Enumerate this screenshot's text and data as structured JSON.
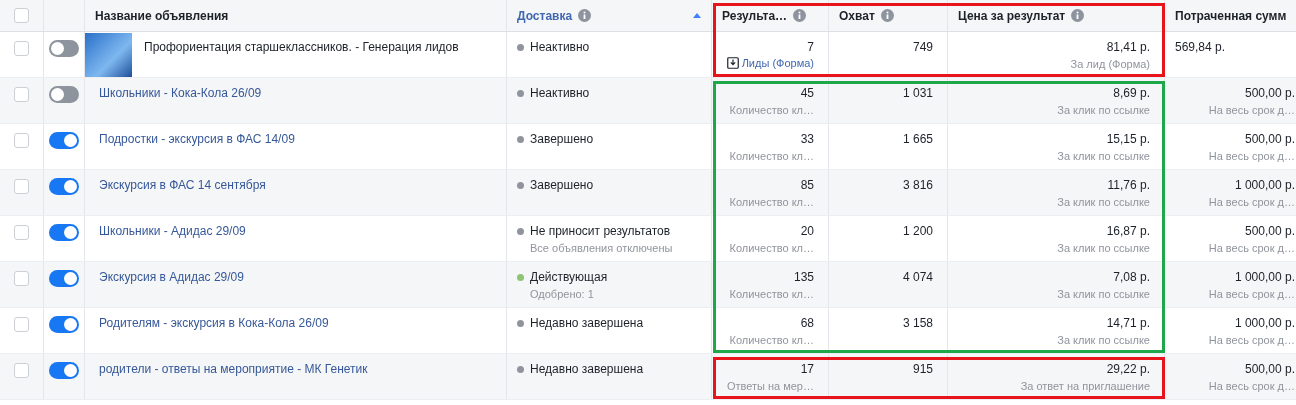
{
  "header": {
    "checked": false,
    "frame": {
      "color": "#e8141c"
    },
    "columns": [
      {
        "label": "Название объявления",
        "info": false,
        "sorted": false
      },
      {
        "label": "Доставка",
        "info": true,
        "sorted": true
      },
      {
        "label": "Результа…",
        "info": true,
        "sorted": false
      },
      {
        "label": "Охват",
        "info": true,
        "sorted": false
      },
      {
        "label": "Цена за результат",
        "info": true,
        "sorted": false
      },
      {
        "label": "Потраченная сумм",
        "info": false,
        "sorted": false
      }
    ]
  },
  "rows": [
    {
      "checked": false,
      "on": false,
      "thumbnail": true,
      "name": "Профориентация старшеклассников. - Генерация лидов",
      "status": {
        "text": "Неактивно",
        "color": "#90949c"
      },
      "results": "7",
      "results_note": {
        "text": "Лиды (Форма)",
        "kind": "form"
      },
      "reach": "749",
      "cost": "81,41 р.",
      "cost_note": "За лид (Форма)",
      "spent": "569,84 р.",
      "frame": {
        "color": "#e8141c"
      }
    },
    {
      "checked": false,
      "on": false,
      "thumbnail": false,
      "name": "Школьники - Кока-Кола 26/09",
      "status": {
        "text": "Неактивно",
        "color": "#90949c"
      },
      "results": "45",
      "results_note": {
        "text": "Количество кл…",
        "kind": "plain"
      },
      "reach": "1 031",
      "cost": "8,69 р.",
      "cost_note": "За клик по ссылке",
      "spent": "500,00 р.",
      "spent_note": "На весь срок д…",
      "frame": {
        "color": "#1fa84a"
      }
    },
    {
      "checked": false,
      "on": true,
      "thumbnail": false,
      "name": "Подростки - экскурсия в ФАС 14/09",
      "status": {
        "text": "Завершено",
        "color": "#90949c"
      },
      "results": "33",
      "results_note": {
        "text": "Количество кл…",
        "kind": "plain"
      },
      "reach": "1 665",
      "cost": "15,15 р.",
      "cost_note": "За клик по ссылке",
      "spent": "500,00 р.",
      "spent_note": "На весь срок д…",
      "frame": {
        "color": "#1fa84a"
      }
    },
    {
      "checked": false,
      "on": true,
      "thumbnail": false,
      "name": "Экскурсия в ФАС 14 сентября",
      "status": {
        "text": "Завершено",
        "color": "#90949c"
      },
      "results": "85",
      "results_note": {
        "text": "Количество кл…",
        "kind": "plain"
      },
      "reach": "3 816",
      "cost": "11,76 р.",
      "cost_note": "За клик по ссылке",
      "spent": "1 000,00 р.",
      "spent_note": "На весь срок д…",
      "frame": {
        "color": "#1fa84a"
      }
    },
    {
      "checked": false,
      "on": true,
      "thumbnail": false,
      "name": "Школьники - Адидас 29/09",
      "status": {
        "text": "Не приносит результатов",
        "note": "Все объявления отключены",
        "color": "#90949c"
      },
      "results": "20",
      "results_note": {
        "text": "Количество кл…",
        "kind": "plain"
      },
      "reach": "1 200",
      "cost": "16,87 р.",
      "cost_note": "За клик по ссылке",
      "spent": "500,00 р.",
      "spent_note": "На весь срок д…",
      "frame": {
        "color": "#1fa84a"
      }
    },
    {
      "checked": false,
      "on": true,
      "thumbnail": false,
      "name": "Экскурсия в Адидас 29/09",
      "status": {
        "text": "Действующая",
        "note": "Одобрено: 1",
        "color": "#8dc572"
      },
      "results": "135",
      "results_note": {
        "text": "Количество кл…",
        "kind": "plain"
      },
      "reach": "4 074",
      "cost": "7,08 р.",
      "cost_note": "За клик по ссылке",
      "spent": "1 000,00 р.",
      "spent_note": "На весь срок д…",
      "frame": {
        "color": "#1fa84a"
      }
    },
    {
      "checked": false,
      "on": true,
      "thumbnail": false,
      "name": "Родителям - экскурсия в Кока-Кола 26/09",
      "status": {
        "text": "Недавно завершена",
        "color": "#90949c"
      },
      "results": "68",
      "results_note": {
        "text": "Количество кл…",
        "kind": "plain"
      },
      "reach": "3 158",
      "cost": "14,71 р.",
      "cost_note": "За клик по ссылке",
      "spent": "1 000,00 р.",
      "spent_note": "На весь срок д…",
      "frame": {
        "color": "#1fa84a"
      }
    },
    {
      "checked": false,
      "on": true,
      "thumbnail": false,
      "name": "родители - ответы на мероприятие - МК Генетик",
      "status": {
        "text": "Недавно завершена",
        "color": "#90949c"
      },
      "results": "17",
      "results_note": {
        "text": "Ответы на мер…",
        "kind": "plain"
      },
      "reach": "915",
      "cost": "29,22 р.",
      "cost_note": "За ответ на приглашение",
      "spent": "500,00 р.",
      "spent_note": "На весь срок д…",
      "frame": {
        "color": "#e8141c"
      }
    }
  ]
}
